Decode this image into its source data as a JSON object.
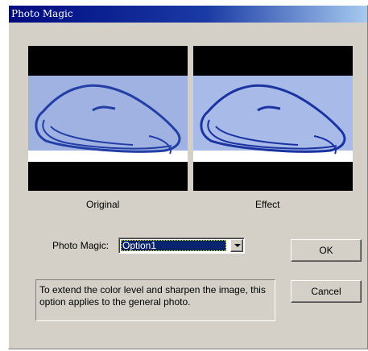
{
  "window": {
    "title": "Photo Magic"
  },
  "previews": {
    "original_caption": "Original",
    "effect_caption": "Effect"
  },
  "controls": {
    "photo_magic_label": "Photo Magic:",
    "photo_magic_selected": "Option1",
    "description": "To extend the color level and sharpen the image, this option applies to the general photo."
  },
  "buttons": {
    "ok_label": "OK",
    "cancel_label": "Cancel"
  },
  "colors": {
    "dialog_face": "#d4d0c8",
    "title_gradient_start": "#000a80",
    "title_gradient_end": "#a6caf0",
    "selection_highlight": "#0a246a",
    "preview_band": "#9fb2e2",
    "preview_ink": "#233fa6"
  },
  "icons": {
    "combo_arrow": "chevron-down-icon"
  }
}
